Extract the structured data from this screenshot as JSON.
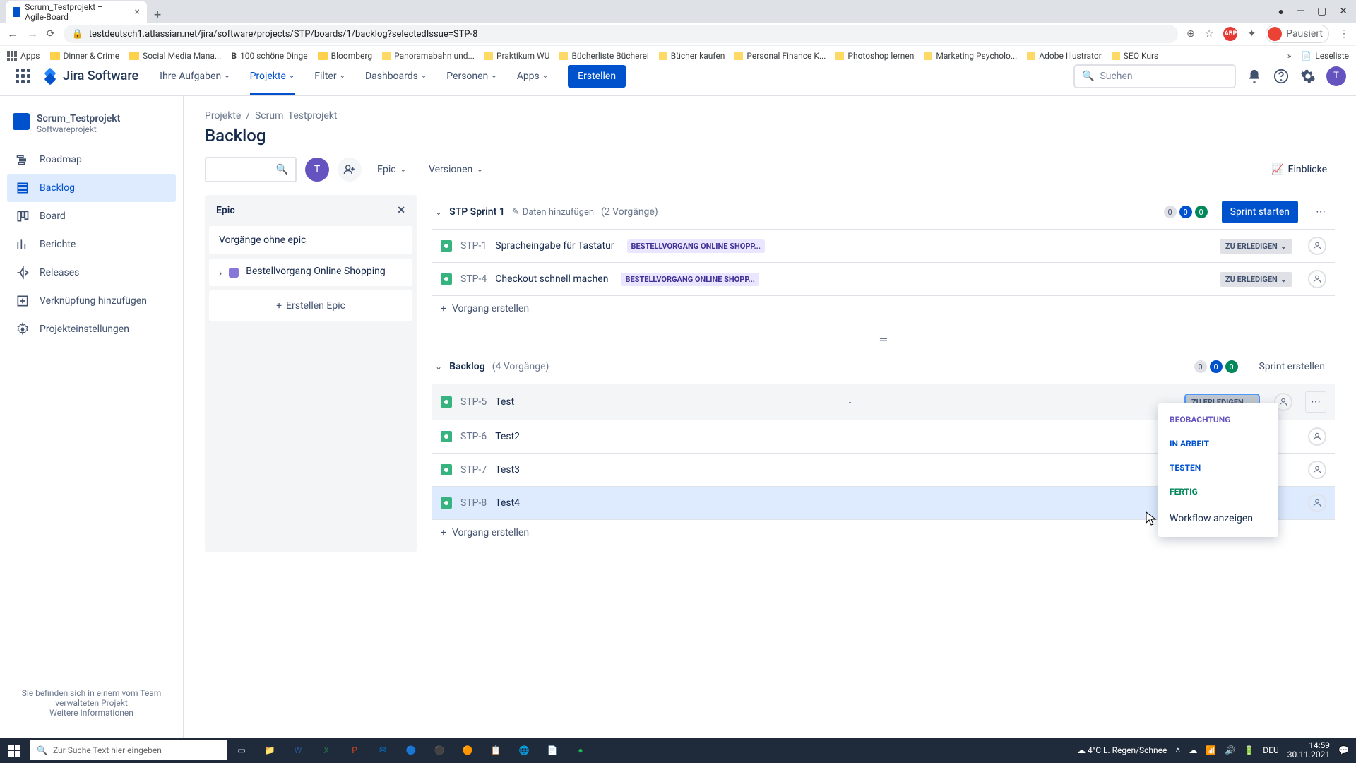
{
  "browser": {
    "tab_title": "Scrum_Testprojekt – Agile-Board",
    "url": "testdeutsch1.atlassian.net/jira/software/projects/STP/boards/1/backlog?selectedIssue=STP-8",
    "profile_label": "Pausiert",
    "bookmarks": {
      "apps": "Apps",
      "b1": "Dinner & Crime",
      "b2": "Social Media Mana...",
      "b3": "100 schöne Dinge",
      "b4": "Bloomberg",
      "b5": "Panoramabahn und...",
      "b6": "Praktikum WU",
      "b7": "Bücherliste Bücherei",
      "b8": "Bücher kaufen",
      "b9": "Personal Finance K...",
      "b10": "Photoshop lernen",
      "b11": "Marketing Psycholo...",
      "b12": "Adobe Illustrator",
      "b13": "SEO Kurs",
      "readlist": "Leseliste"
    }
  },
  "header": {
    "logo": "Jira Software",
    "nav": {
      "tasks": "Ihre Aufgaben",
      "projects": "Projekte",
      "filters": "Filter",
      "dashboards": "Dashboards",
      "people": "Personen",
      "apps": "Apps"
    },
    "create": "Erstellen",
    "search_placeholder": "Suchen"
  },
  "sidebar": {
    "project_name": "Scrum_Testprojekt",
    "project_type": "Softwareprojekt",
    "items": {
      "roadmap": "Roadmap",
      "backlog": "Backlog",
      "board": "Board",
      "reports": "Berichte",
      "releases": "Releases",
      "link": "Verknüpfung hinzufügen",
      "settings": "Projekteinstellungen"
    },
    "footer_text": "Sie befinden sich in einem vom Team verwalteten Projekt",
    "footer_link": "Weitere Informationen"
  },
  "breadcrumb": {
    "projects": "Projekte",
    "project": "Scrum_Testprojekt"
  },
  "page_title": "Backlog",
  "toolbar": {
    "epic": "Epic",
    "versions": "Versionen",
    "insights": "Einblicke"
  },
  "epic_panel": {
    "title": "Epic",
    "no_epic": "Vorgänge ohne epic",
    "epic1": "Bestellvorgang Online Shopping",
    "create": "Erstellen Epic"
  },
  "sprint": {
    "title": "STP Sprint 1",
    "add_data": "Daten hinzufügen",
    "count": "(2 Vorgänge)",
    "badges": {
      "a": "0",
      "b": "0",
      "c": "0"
    },
    "start": "Sprint starten",
    "issue1": {
      "key": "STP-1",
      "title": "Spracheingabe für Tastatur",
      "epic": "BESTELLVORGANG ONLINE SHOPP..."
    },
    "issue2": {
      "key": "STP-4",
      "title": "Checkout schnell machen",
      "epic": "BESTELLVORGANG ONLINE SHOPP..."
    },
    "status": "ZU ERLEDIGEN",
    "create": "Vorgang erstellen"
  },
  "backlog": {
    "title": "Backlog",
    "count": "(4 Vorgänge)",
    "badges": {
      "a": "0",
      "b": "0",
      "c": "0"
    },
    "create_sprint": "Sprint erstellen",
    "issue1": {
      "key": "STP-5",
      "title": "Test"
    },
    "issue2": {
      "key": "STP-6",
      "title": "Test2"
    },
    "issue3": {
      "key": "STP-7",
      "title": "Test3"
    },
    "issue4": {
      "key": "STP-8",
      "title": "Test4"
    },
    "status": "ZU ERLEDIGEN",
    "priority_dash": "-",
    "create": "Vorgang erstellen"
  },
  "status_menu": {
    "beob": "BEOBACHTUNG",
    "arbeit": "IN ARBEIT",
    "testen": "TESTEN",
    "fertig": "FERTIG",
    "workflow": "Workflow anzeigen"
  },
  "taskbar": {
    "search": "Zur Suche Text hier eingeben",
    "weather": "4°C  L. Regen/Schnee",
    "lang": "DEU",
    "time": "14:59",
    "date": "30.11.2021"
  }
}
